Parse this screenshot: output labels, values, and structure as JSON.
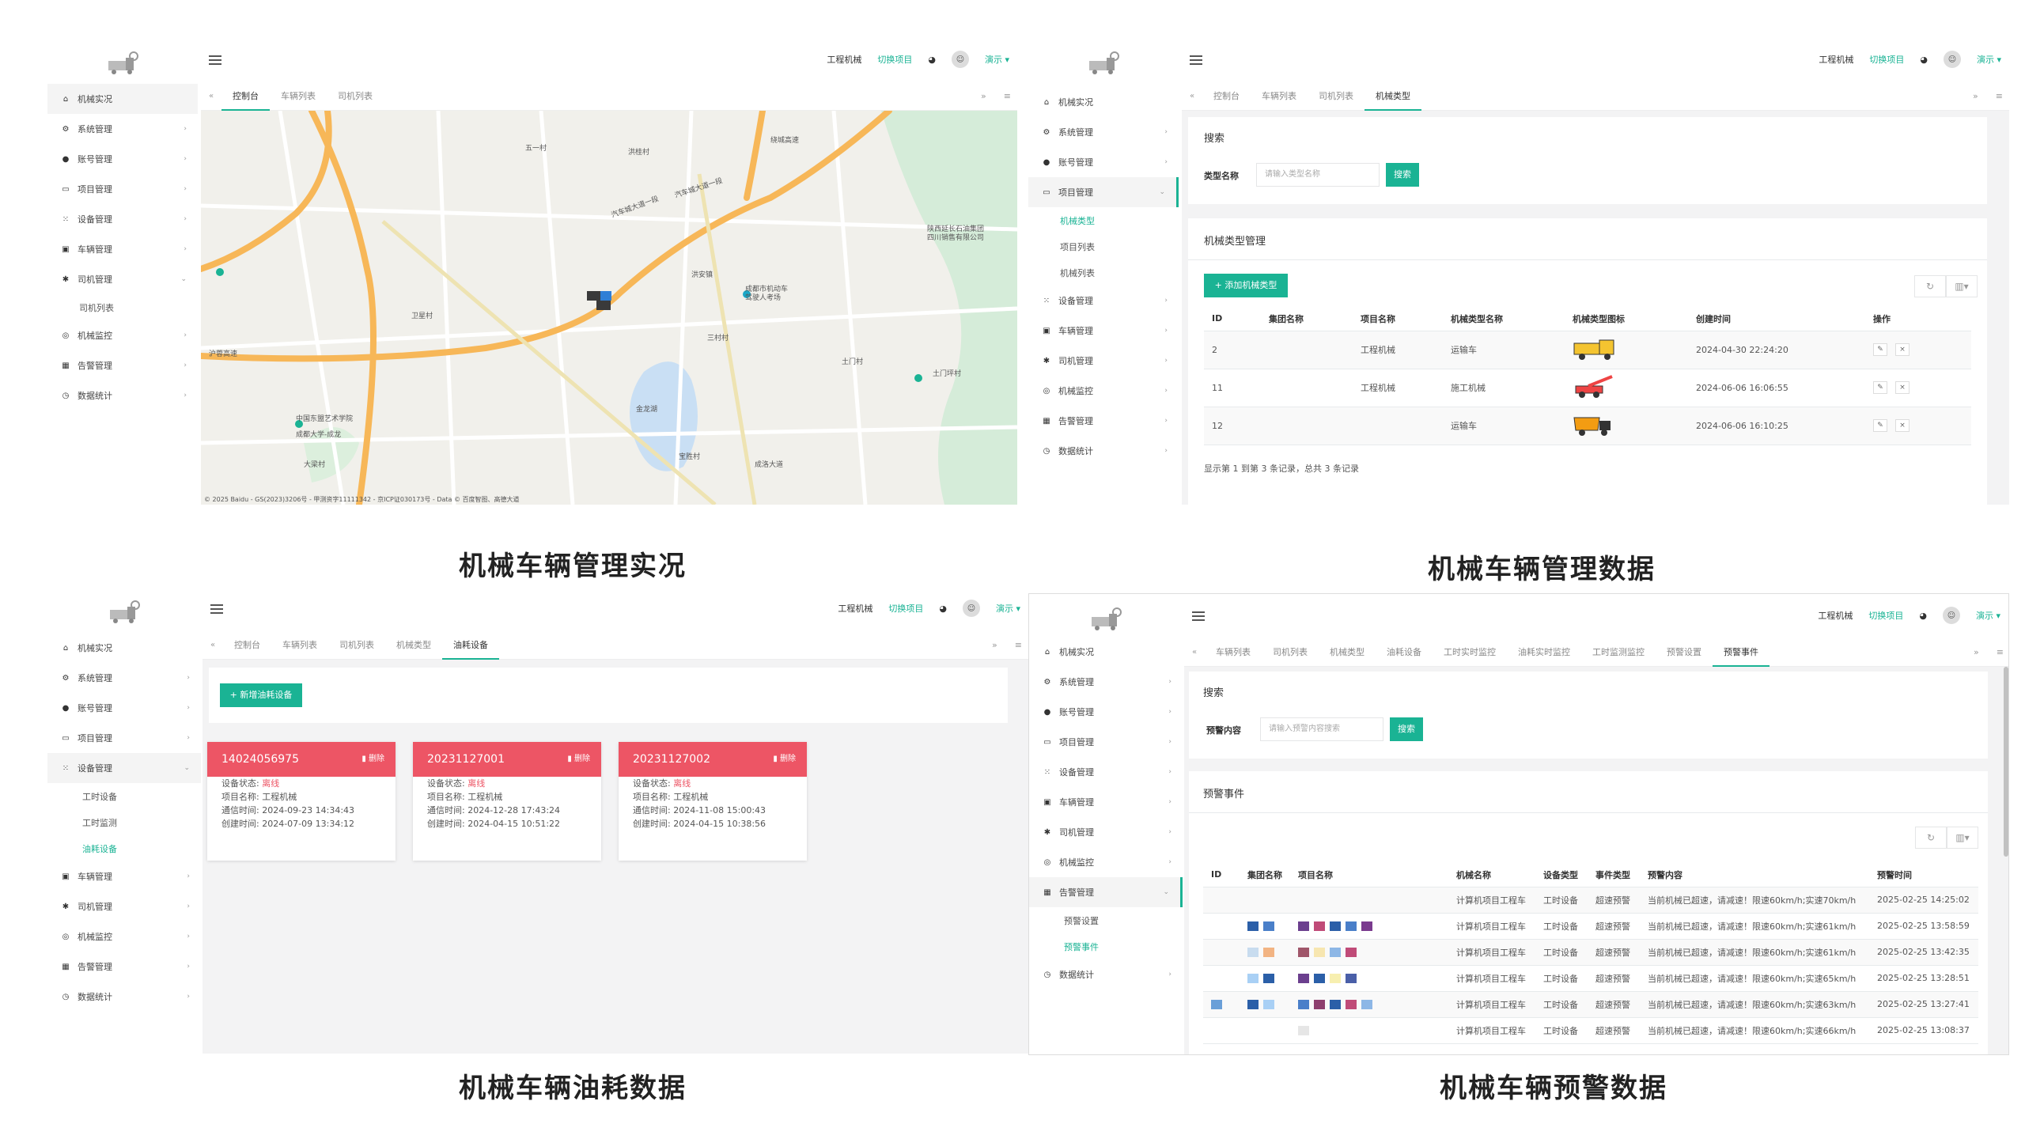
{
  "captions": {
    "p1": "机械车辆管理实况",
    "p2": "机械车辆管理数据",
    "p3": "机械车辆油耗数据",
    "p4": "机械车辆预警数据"
  },
  "header": {
    "project": "工程机械",
    "switch": "切换项目",
    "user": "演示 ▾"
  },
  "menu": {
    "live": "机械实况",
    "system": "系统管理",
    "account": "账号管理",
    "project": "项目管理",
    "device": "设备管理",
    "vehicle": "车辆管理",
    "driver": "司机管理",
    "driver_list": "司机列表",
    "monitor": "机械监控",
    "alarm": "告警管理",
    "stats": "数据统计",
    "machine_type": "机械类型",
    "project_list": "项目列表",
    "machine_list": "机械列表",
    "worktime_device": "工时设备",
    "worktime_monitor": "工时监测",
    "fuel_device": "油耗设备",
    "alarm_setting": "预警设置",
    "alarm_event": "预警事件"
  },
  "tabs": {
    "console": "控制台",
    "vehicle_list": "车辆列表",
    "driver_list": "司机列表",
    "machine_type": "机械类型",
    "fuel_device": "油耗设备",
    "worktime_live": "工时实时监控",
    "fuel_live": "油耗实时监控",
    "worktime_stats": "工时监测监控",
    "alarm_setting": "预警设置",
    "alarm_event": "预警事件"
  },
  "map": {
    "labels": [
      {
        "t": "汽车城大道一段"
      },
      {
        "t": "沪蓉高速"
      },
      {
        "t": "成都市机动车\n驾驶人考场"
      },
      {
        "t": "洪安镇"
      },
      {
        "t": "绕城高速"
      },
      {
        "t": "五一村"
      },
      {
        "t": "洪桂村"
      },
      {
        "t": "三村村"
      },
      {
        "t": "土门村"
      },
      {
        "t": "成洛大道"
      },
      {
        "t": "中国东盟艺术学院"
      },
      {
        "t": "成都大学-成龙"
      },
      {
        "t": "汽车城大道一段"
      },
      {
        "t": "陕西延长石油集团\n四川销售有限公司"
      },
      {
        "t": "金龙湖"
      },
      {
        "t": "卫星村"
      },
      {
        "t": "大梁村"
      },
      {
        "t": "土门坪村"
      },
      {
        "t": "宝胜村"
      }
    ],
    "copyright": "© 2025 Baidu - GS(2023)3206号 - 甲测资字11111342 - 京ICP证030173号 - Data © 百度智图、高德大道"
  },
  "type_mgmt": {
    "search_title": "搜索",
    "type_name_label": "类型名称",
    "type_name_placeholder": "请输入类型名称",
    "search_btn": "搜索",
    "section_title": "机械类型管理",
    "add_btn": "+ 添加机械类型",
    "columns": [
      "ID",
      "集团名称",
      "项目名称",
      "机械类型名称",
      "机械类型图标",
      "创建时间",
      "操作"
    ],
    "rows": [
      {
        "id": "2",
        "group": "",
        "project": "工程机械",
        "type": "运输车",
        "icon": "truck-icon",
        "created": "2024-04-30 22:24:20"
      },
      {
        "id": "11",
        "group": "",
        "project": "工程机械",
        "type": "施工机械",
        "icon": "crane-icon",
        "created": "2024-06-06 16:06:55"
      },
      {
        "id": "12",
        "group": "",
        "project": "",
        "type": "运输车",
        "icon": "dump-truck-icon",
        "created": "2024-06-06 16:10:25"
      }
    ],
    "footer": "显示第 1 到第 3 条记录，总共 3 条记录"
  },
  "fuel": {
    "add_btn": "+ 新增油耗设备",
    "delete_label": "删除",
    "status_label": "设备状态:",
    "project_label": "项目名称:",
    "comm_label": "通信时间:",
    "created_label": "创建时间:",
    "cards": [
      {
        "code": "14024056975",
        "status": "离线",
        "project": "工程机械",
        "comm": "2024-09-23 14:34:43",
        "created": "2024-07-09 13:34:12"
      },
      {
        "code": "20231127001",
        "status": "离线",
        "project": "工程机械",
        "comm": "2024-12-28 17:43:24",
        "created": "2024-04-15 10:51:22"
      },
      {
        "code": "20231127002",
        "status": "离线",
        "project": "工程机械",
        "comm": "2024-11-08 15:00:43",
        "created": "2024-04-15 10:38:56"
      }
    ]
  },
  "alarm": {
    "search_title": "搜索",
    "content_label": "预警内容",
    "content_placeholder": "请输入预警内容搜索",
    "search_btn": "搜索",
    "section_title": "预警事件",
    "columns": [
      "ID",
      "集团名称",
      "项目名称",
      "机械名称",
      "设备类型",
      "事件类型",
      "预警内容",
      "预警时间"
    ],
    "rows": [
      {
        "machine": "计算机项目工程车",
        "dev": "工时设备",
        "evt": "超速预警",
        "content": "当前机械已超速，请减速！限速60km/h;实速70km/h",
        "time": "2025-02-25 14:25:02"
      },
      {
        "machine": "计算机项目工程车",
        "dev": "工时设备",
        "evt": "超速预警",
        "content": "当前机械已超速，请减速！限速60km/h;实速61km/h",
        "time": "2025-02-25 13:58:59"
      },
      {
        "machine": "计算机项目工程车",
        "dev": "工时设备",
        "evt": "超速预警",
        "content": "当前机械已超速，请减速！限速60km/h;实速61km/h",
        "time": "2025-02-25 13:42:35"
      },
      {
        "machine": "计算机项目工程车",
        "dev": "工时设备",
        "evt": "超速预警",
        "content": "当前机械已超速，请减速！限速60km/h;实速65km/h",
        "time": "2025-02-25 13:28:51"
      },
      {
        "machine": "计算机项目工程车",
        "dev": "工时设备",
        "evt": "超速预警",
        "content": "当前机械已超速，请减速！限速60km/h;实速63km/h",
        "time": "2025-02-25 13:27:41"
      },
      {
        "machine": "计算机项目工程车",
        "dev": "工时设备",
        "evt": "超速预警",
        "content": "当前机械已超速，请减速！限速60km/h;实速66km/h",
        "time": "2025-02-25 13:08:37"
      }
    ]
  }
}
